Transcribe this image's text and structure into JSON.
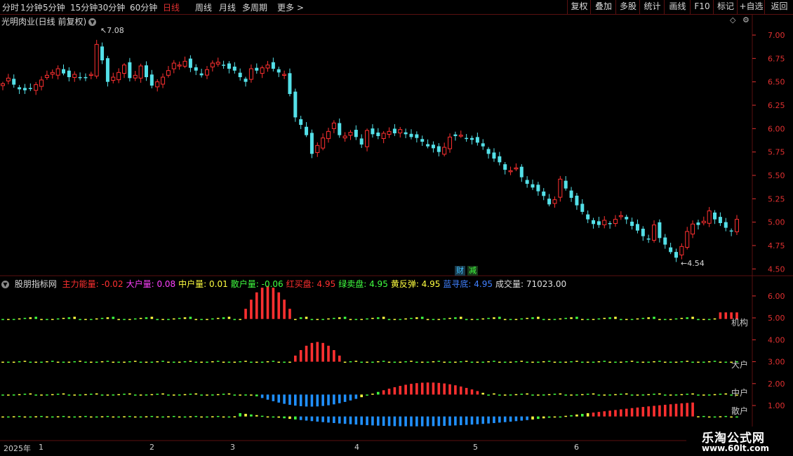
{
  "toolbar": {
    "periods": [
      {
        "label": "分时",
        "active": false
      },
      {
        "label": "1分钟",
        "active": false
      },
      {
        "label": "5分钟",
        "active": false
      },
      {
        "label": "15分钟",
        "active": false
      },
      {
        "label": "30分钟",
        "active": false
      },
      {
        "label": "60分钟",
        "active": false
      },
      {
        "label": "日线",
        "active": true
      },
      {
        "label": "周线",
        "active": false
      },
      {
        "label": "月线",
        "active": false
      },
      {
        "label": "多周期",
        "active": false
      },
      {
        "label": "更多 >",
        "active": false
      }
    ],
    "right_buttons": [
      "复权",
      "叠加",
      "多股",
      "统计",
      "画线",
      "F10",
      "标记",
      "+自选",
      "返回"
    ]
  },
  "chart_title": "光明肉业(日线 前复权)",
  "indicator": {
    "name": "股朋指标网",
    "items": [
      {
        "label": "主力能量:",
        "value": "-0.02",
        "color": "#ff3030"
      },
      {
        "label": "大户量:",
        "value": "0.08",
        "color": "#ff40ff"
      },
      {
        "label": "中户量:",
        "value": "0.01",
        "color": "#ffff40"
      },
      {
        "label": "散户量:",
        "value": "-0.06",
        "color": "#40ff40"
      },
      {
        "label": "红买盘:",
        "value": "4.95",
        "color": "#ff3030"
      },
      {
        "label": "绿卖盘:",
        "value": "4.95",
        "color": "#40ff40"
      },
      {
        "label": "黄反弹:",
        "value": "4.95",
        "color": "#ffff40"
      },
      {
        "label": "蓝寻底:",
        "value": "4.95",
        "color": "#4080ff"
      },
      {
        "label": "成交量:",
        "value": "71023.00",
        "color": "#e0e0e0"
      }
    ],
    "right_labels": [
      {
        "text": "机构",
        "color": "#ff3030"
      },
      {
        "text": "大户",
        "color": "#ff40ff"
      },
      {
        "text": "中户",
        "color": "#ffff40"
      },
      {
        "text": "散户",
        "color": "#40ff40"
      }
    ]
  },
  "annotations": {
    "high": "7.08",
    "low": "4.54"
  },
  "badges": [
    {
      "text": "财",
      "color": "#40c0ff"
    },
    {
      "text": "减",
      "color": "#40ff40"
    }
  ],
  "dates": {
    "year": "2025年",
    "months": [
      "1",
      "2",
      "3",
      "4",
      "5",
      "6"
    ]
  },
  "watermark": {
    "line1": "乐淘公式网",
    "line2": "www.60lt.com"
  },
  "colors": {
    "up": "#ff3030",
    "down": "#54e0e8",
    "grid": "#5a1010"
  },
  "chart_data": {
    "type": "candlestick",
    "price_axis": {
      "ticks": [
        "7.00",
        "6.75",
        "6.50",
        "6.25",
        "6.00",
        "5.75",
        "5.50",
        "5.25",
        "5.00",
        "4.75",
        "4.50"
      ],
      "ylim": [
        4.45,
        7.15
      ]
    },
    "indicator_axis": {
      "ticks": [
        "6.00",
        "5.00",
        "4.00",
        "3.00",
        "2.00",
        "1.00"
      ],
      "ylim": [
        -0.6,
        6.7
      ]
    },
    "closes": [
      6.48,
      6.54,
      6.47,
      6.42,
      6.41,
      6.43,
      6.47,
      6.52,
      6.57,
      6.6,
      6.64,
      6.59,
      6.55,
      6.58,
      6.54,
      6.55,
      6.58,
      6.9,
      6.73,
      6.5,
      6.55,
      6.6,
      6.68,
      6.54,
      6.57,
      6.67,
      6.55,
      6.46,
      6.5,
      6.55,
      6.62,
      6.7,
      6.68,
      6.72,
      6.65,
      6.62,
      6.57,
      6.63,
      6.7,
      6.71,
      6.68,
      6.64,
      6.62,
      6.55,
      6.5,
      6.64,
      6.62,
      6.65,
      6.68,
      6.64,
      6.6,
      6.58,
      6.37,
      6.12,
      6.04,
      5.93,
      5.73,
      5.82,
      5.9,
      5.97,
      6.06,
      5.93,
      5.92,
      5.96,
      5.91,
      5.83,
      5.98,
      5.94,
      5.92,
      5.95,
      5.97,
      5.95,
      5.99,
      5.94,
      5.91,
      5.9,
      5.86,
      5.81,
      5.79,
      5.75,
      5.8,
      5.91,
      5.92,
      5.93,
      5.9,
      5.88,
      5.85,
      5.81,
      5.73,
      5.68,
      5.64,
      5.56,
      5.55,
      5.58,
      5.48,
      5.41,
      5.37,
      5.33,
      5.28,
      5.19,
      5.24,
      5.46,
      5.36,
      5.26,
      5.18,
      5.11,
      5.03,
      4.98,
      4.97,
      5.02,
      4.98,
      5.03,
      5.07,
      5.03,
      4.96,
      4.91,
      4.85,
      4.82,
      4.97,
      4.83,
      4.76,
      4.68,
      4.62,
      4.74,
      4.9,
      4.98,
      4.97,
      5.01,
      5.12,
      5.03,
      4.99,
      4.94,
      4.9,
      5.03
    ],
    "volume_value": "71023.00",
    "last_values": {
      "主力能量": -0.02,
      "大户量": 0.08,
      "中户量": 0.01,
      "散户量": -0.06
    }
  }
}
